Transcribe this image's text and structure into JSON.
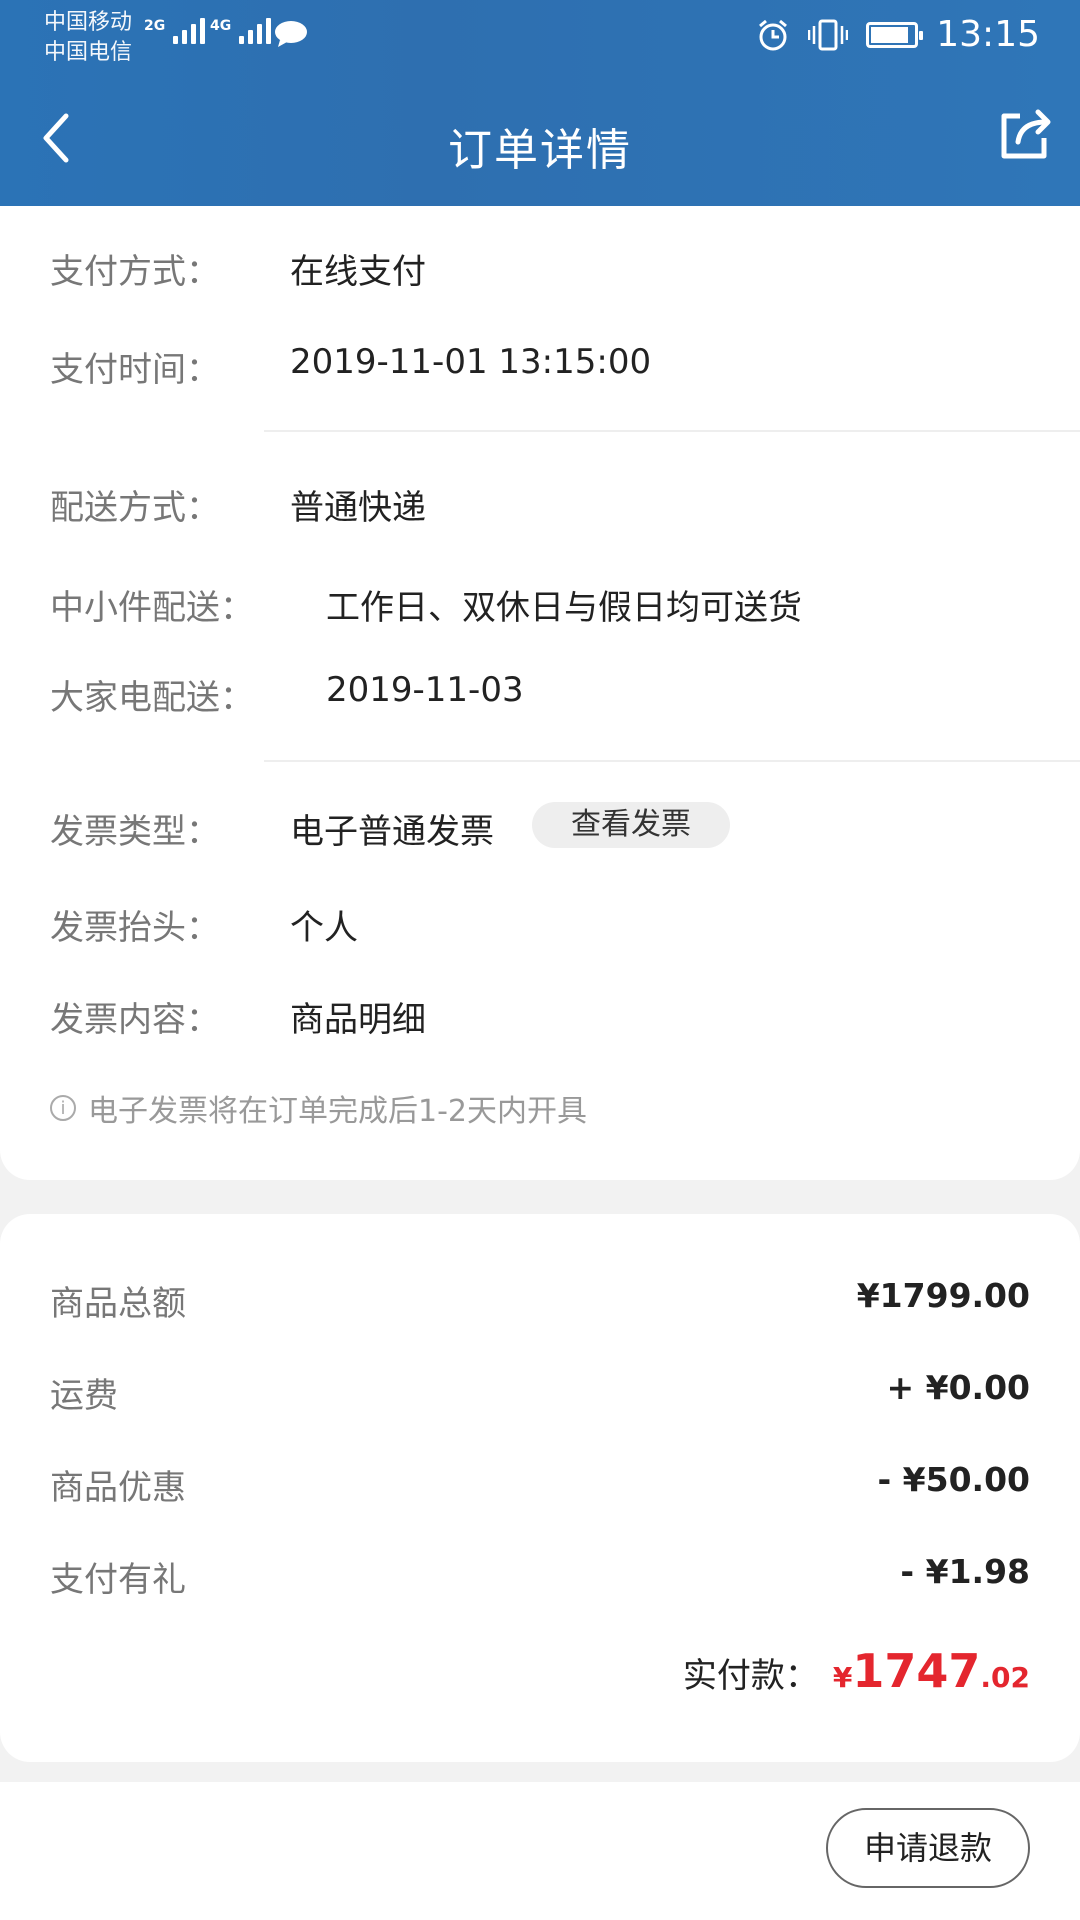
{
  "status_bar": {
    "carrier1": "中国移动",
    "carrier2": "中国电信",
    "net1": "2G",
    "net2": "4G",
    "time": "13:15",
    "icons": [
      "signal-icon",
      "chat-icon",
      "alarm-icon",
      "vibrate-icon",
      "battery-icon"
    ]
  },
  "header": {
    "title": "订单详情",
    "back_icon": "chevron-left-icon",
    "share_icon": "share-icon",
    "color": "#2e72b4"
  },
  "order_info": {
    "payment_method_label": "支付方式：",
    "payment_method_value": "在线支付",
    "payment_time_label": "支付时间：",
    "payment_time_value": "2019-11-01 13:15:00",
    "delivery_method_label": "配送方式：",
    "delivery_method_value": "普通快递",
    "small_item_label": "中小件配送：",
    "small_item_value": "工作日、双休日与假日均可送货",
    "large_appliance_label": "大家电配送：",
    "large_appliance_value": "2019-11-03",
    "invoice_type_label": "发票类型：",
    "invoice_type_value": "电子普通发票",
    "view_invoice_label": "查看发票",
    "invoice_title_label": "发票抬头：",
    "invoice_title_value": "个人",
    "invoice_content_label": "发票内容：",
    "invoice_content_value": "商品明细",
    "tip_text": "电子发票将在订单完成后1-2天内开具"
  },
  "price": {
    "items": [
      {
        "label": "商品总额",
        "value": "¥1799.00"
      },
      {
        "label": "运费",
        "value": "+ ¥0.00"
      },
      {
        "label": "商品优惠",
        "value": "- ¥50.00"
      },
      {
        "label": "支付有礼",
        "value": "- ¥1.98"
      }
    ],
    "total_label": "实付款：",
    "total_currency": "¥",
    "total_integer": "1747",
    "total_decimal": ".02",
    "accent": "#e4262e"
  },
  "actions": {
    "refund_label": "申请退款"
  }
}
